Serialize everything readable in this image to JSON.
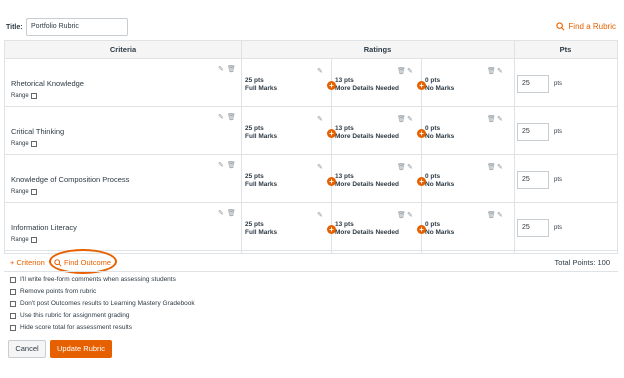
{
  "title_label": "Title:",
  "title_value": "Portfolio Rubric",
  "find_rubric": "Find a Rubric",
  "headers": {
    "criteria": "Criteria",
    "ratings": "Ratings",
    "pts": "Pts"
  },
  "criteria": [
    {
      "name": "Rhetorical Knowledge",
      "range": "Range",
      "ratings": [
        {
          "pts": "25 pts",
          "desc": "Full Marks"
        },
        {
          "pts": "13 pts",
          "desc": "More Details Needed"
        },
        {
          "pts": "0 pts",
          "desc": "No Marks"
        }
      ],
      "points": "25",
      "unit": "pts"
    },
    {
      "name": "Critical Thinking",
      "range": "Range",
      "ratings": [
        {
          "pts": "25 pts",
          "desc": "Full Marks"
        },
        {
          "pts": "13 pts",
          "desc": "More Details Needed"
        },
        {
          "pts": "0 pts",
          "desc": "No Marks"
        }
      ],
      "points": "25",
      "unit": "pts"
    },
    {
      "name": "Knowledge of Composition Process",
      "range": "Range",
      "ratings": [
        {
          "pts": "25 pts",
          "desc": "Full Marks"
        },
        {
          "pts": "13 pts",
          "desc": "More Details Needed"
        },
        {
          "pts": "0 pts",
          "desc": "No Marks"
        }
      ],
      "points": "25",
      "unit": "pts"
    },
    {
      "name": "Information Literacy",
      "range": "Range",
      "ratings": [
        {
          "pts": "25 pts",
          "desc": "Full Marks"
        },
        {
          "pts": "13 pts",
          "desc": "More Details Needed"
        },
        {
          "pts": "0 pts",
          "desc": "No Marks"
        }
      ],
      "points": "25",
      "unit": "pts"
    }
  ],
  "add_criterion": "+ Criterion",
  "find_outcome": "Find Outcome",
  "total_points": "Total Points: 100",
  "options": [
    "I'll write free-form comments when assessing students",
    "Remove points from rubric",
    "Don't post Outcomes results to Learning Mastery Gradebook",
    "Use this rubric for assignment grading",
    "Hide score total for assessment results"
  ],
  "buttons": {
    "cancel": "Cancel",
    "update": "Update Rubric"
  },
  "colors": {
    "accent": "#e66000",
    "border": "#dfe3e6",
    "text": "#2d3b45"
  }
}
